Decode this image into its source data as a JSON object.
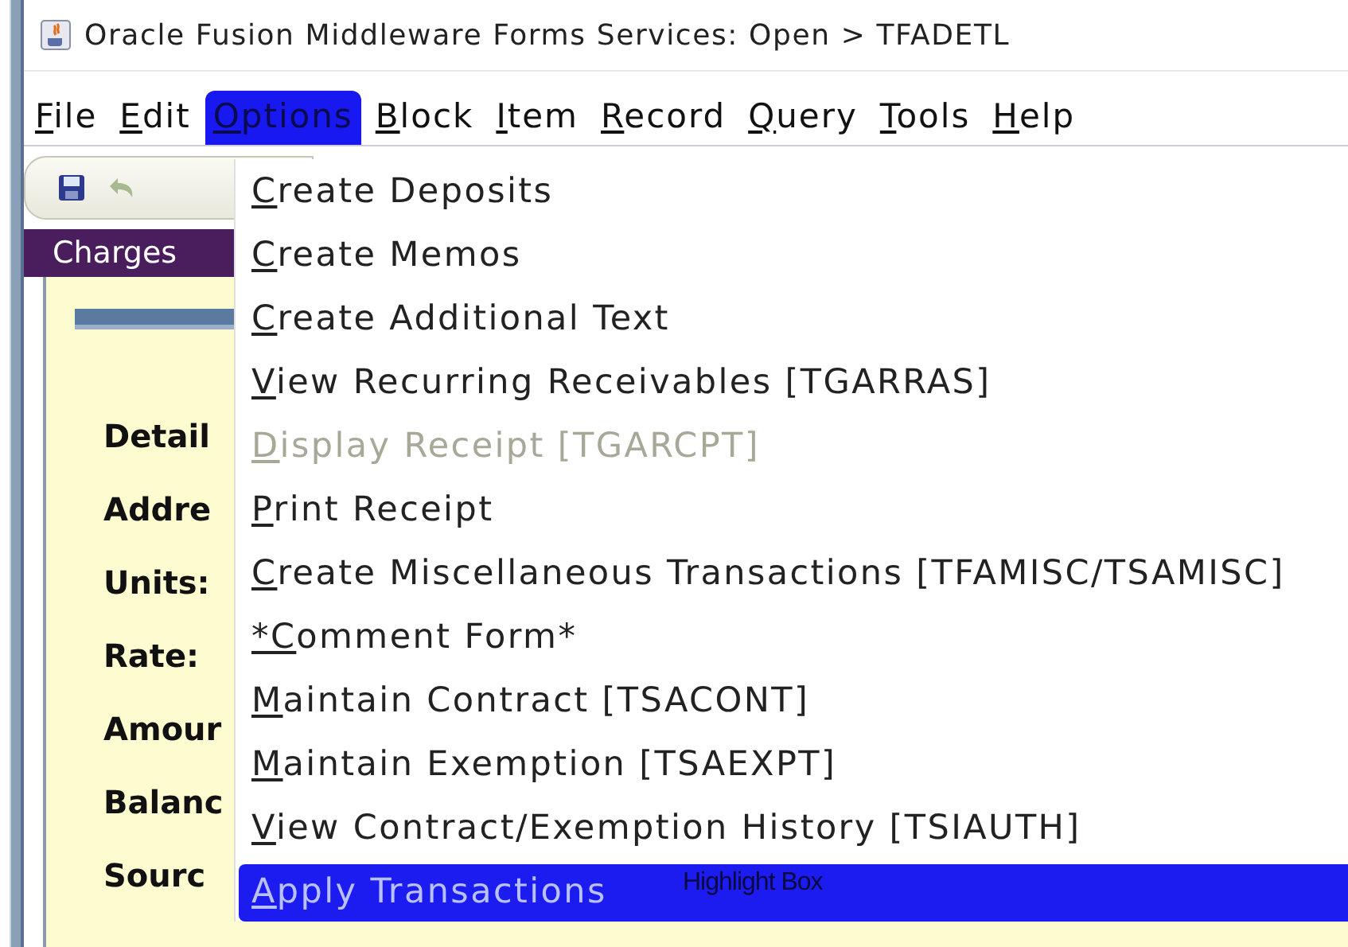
{
  "window": {
    "title": "Oracle Fusion Middleware Forms Services:  Open > TFADETL"
  },
  "menubar": [
    {
      "label": "File",
      "selected": false
    },
    {
      "label": "Edit",
      "selected": false
    },
    {
      "label": "Options",
      "selected": true
    },
    {
      "label": "Block",
      "selected": false
    },
    {
      "label": "Item",
      "selected": false
    },
    {
      "label": "Record",
      "selected": false
    },
    {
      "label": "Query",
      "selected": false
    },
    {
      "label": "Tools",
      "selected": false
    },
    {
      "label": "Help",
      "selected": false
    }
  ],
  "block_title": "Charges",
  "form_labels": [
    "Detail",
    "Addre",
    "Units:",
    "Rate:",
    "Amour",
    "Balanc",
    "Sourc"
  ],
  "options_menu": [
    {
      "label": "Create Deposits",
      "disabled": false,
      "selected": false
    },
    {
      "label": "Create Memos",
      "disabled": false,
      "selected": false
    },
    {
      "label": "Create Additional Text",
      "disabled": false,
      "selected": false
    },
    {
      "label": "View Recurring Receivables [TGARRAS]",
      "disabled": false,
      "selected": false
    },
    {
      "label": "Display Receipt [TGARCPT]",
      "disabled": true,
      "selected": false
    },
    {
      "label": "Print Receipt",
      "disabled": false,
      "selected": false
    },
    {
      "label": "Create Miscellaneous Transactions [TFAMISC/TSAMISC]",
      "disabled": false,
      "selected": false
    },
    {
      "label": "*Comment Form*",
      "disabled": false,
      "selected": false
    },
    {
      "label": "Maintain Contract [TSACONT]",
      "disabled": false,
      "selected": false
    },
    {
      "label": "Maintain Exemption [TSAEXPT]",
      "disabled": false,
      "selected": false
    },
    {
      "label": "View Contract/Exemption History [TSIAUTH]",
      "disabled": false,
      "selected": false
    },
    {
      "label": "Apply Transactions",
      "disabled": false,
      "selected": true
    }
  ],
  "annotation": "Highlight Box"
}
